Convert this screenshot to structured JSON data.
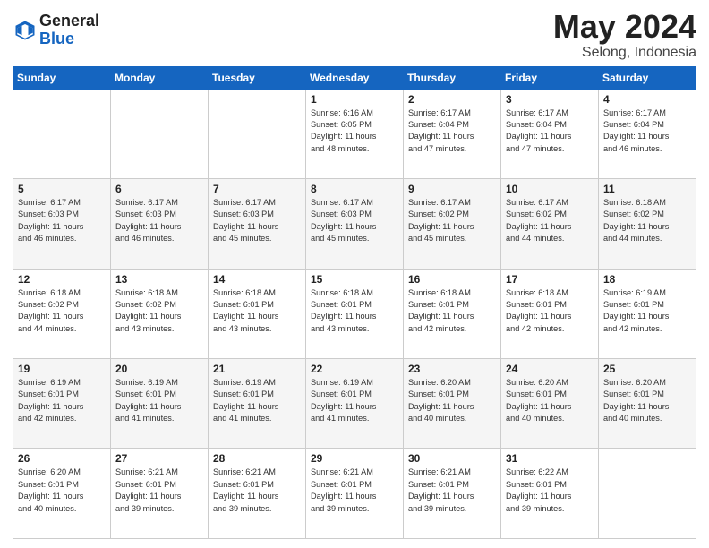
{
  "logo": {
    "general": "General",
    "blue": "Blue"
  },
  "title": {
    "month_year": "May 2024",
    "location": "Selong, Indonesia"
  },
  "weekdays": [
    "Sunday",
    "Monday",
    "Tuesday",
    "Wednesday",
    "Thursday",
    "Friday",
    "Saturday"
  ],
  "weeks": [
    [
      {
        "day": "",
        "info": ""
      },
      {
        "day": "",
        "info": ""
      },
      {
        "day": "",
        "info": ""
      },
      {
        "day": "1",
        "info": "Sunrise: 6:16 AM\nSunset: 6:05 PM\nDaylight: 11 hours\nand 48 minutes."
      },
      {
        "day": "2",
        "info": "Sunrise: 6:17 AM\nSunset: 6:04 PM\nDaylight: 11 hours\nand 47 minutes."
      },
      {
        "day": "3",
        "info": "Sunrise: 6:17 AM\nSunset: 6:04 PM\nDaylight: 11 hours\nand 47 minutes."
      },
      {
        "day": "4",
        "info": "Sunrise: 6:17 AM\nSunset: 6:04 PM\nDaylight: 11 hours\nand 46 minutes."
      }
    ],
    [
      {
        "day": "5",
        "info": "Sunrise: 6:17 AM\nSunset: 6:03 PM\nDaylight: 11 hours\nand 46 minutes."
      },
      {
        "day": "6",
        "info": "Sunrise: 6:17 AM\nSunset: 6:03 PM\nDaylight: 11 hours\nand 46 minutes."
      },
      {
        "day": "7",
        "info": "Sunrise: 6:17 AM\nSunset: 6:03 PM\nDaylight: 11 hours\nand 45 minutes."
      },
      {
        "day": "8",
        "info": "Sunrise: 6:17 AM\nSunset: 6:03 PM\nDaylight: 11 hours\nand 45 minutes."
      },
      {
        "day": "9",
        "info": "Sunrise: 6:17 AM\nSunset: 6:02 PM\nDaylight: 11 hours\nand 45 minutes."
      },
      {
        "day": "10",
        "info": "Sunrise: 6:17 AM\nSunset: 6:02 PM\nDaylight: 11 hours\nand 44 minutes."
      },
      {
        "day": "11",
        "info": "Sunrise: 6:18 AM\nSunset: 6:02 PM\nDaylight: 11 hours\nand 44 minutes."
      }
    ],
    [
      {
        "day": "12",
        "info": "Sunrise: 6:18 AM\nSunset: 6:02 PM\nDaylight: 11 hours\nand 44 minutes."
      },
      {
        "day": "13",
        "info": "Sunrise: 6:18 AM\nSunset: 6:02 PM\nDaylight: 11 hours\nand 43 minutes."
      },
      {
        "day": "14",
        "info": "Sunrise: 6:18 AM\nSunset: 6:01 PM\nDaylight: 11 hours\nand 43 minutes."
      },
      {
        "day": "15",
        "info": "Sunrise: 6:18 AM\nSunset: 6:01 PM\nDaylight: 11 hours\nand 43 minutes."
      },
      {
        "day": "16",
        "info": "Sunrise: 6:18 AM\nSunset: 6:01 PM\nDaylight: 11 hours\nand 42 minutes."
      },
      {
        "day": "17",
        "info": "Sunrise: 6:18 AM\nSunset: 6:01 PM\nDaylight: 11 hours\nand 42 minutes."
      },
      {
        "day": "18",
        "info": "Sunrise: 6:19 AM\nSunset: 6:01 PM\nDaylight: 11 hours\nand 42 minutes."
      }
    ],
    [
      {
        "day": "19",
        "info": "Sunrise: 6:19 AM\nSunset: 6:01 PM\nDaylight: 11 hours\nand 42 minutes."
      },
      {
        "day": "20",
        "info": "Sunrise: 6:19 AM\nSunset: 6:01 PM\nDaylight: 11 hours\nand 41 minutes."
      },
      {
        "day": "21",
        "info": "Sunrise: 6:19 AM\nSunset: 6:01 PM\nDaylight: 11 hours\nand 41 minutes."
      },
      {
        "day": "22",
        "info": "Sunrise: 6:19 AM\nSunset: 6:01 PM\nDaylight: 11 hours\nand 41 minutes."
      },
      {
        "day": "23",
        "info": "Sunrise: 6:20 AM\nSunset: 6:01 PM\nDaylight: 11 hours\nand 40 minutes."
      },
      {
        "day": "24",
        "info": "Sunrise: 6:20 AM\nSunset: 6:01 PM\nDaylight: 11 hours\nand 40 minutes."
      },
      {
        "day": "25",
        "info": "Sunrise: 6:20 AM\nSunset: 6:01 PM\nDaylight: 11 hours\nand 40 minutes."
      }
    ],
    [
      {
        "day": "26",
        "info": "Sunrise: 6:20 AM\nSunset: 6:01 PM\nDaylight: 11 hours\nand 40 minutes."
      },
      {
        "day": "27",
        "info": "Sunrise: 6:21 AM\nSunset: 6:01 PM\nDaylight: 11 hours\nand 39 minutes."
      },
      {
        "day": "28",
        "info": "Sunrise: 6:21 AM\nSunset: 6:01 PM\nDaylight: 11 hours\nand 39 minutes."
      },
      {
        "day": "29",
        "info": "Sunrise: 6:21 AM\nSunset: 6:01 PM\nDaylight: 11 hours\nand 39 minutes."
      },
      {
        "day": "30",
        "info": "Sunrise: 6:21 AM\nSunset: 6:01 PM\nDaylight: 11 hours\nand 39 minutes."
      },
      {
        "day": "31",
        "info": "Sunrise: 6:22 AM\nSunset: 6:01 PM\nDaylight: 11 hours\nand 39 minutes."
      },
      {
        "day": "",
        "info": ""
      }
    ]
  ]
}
